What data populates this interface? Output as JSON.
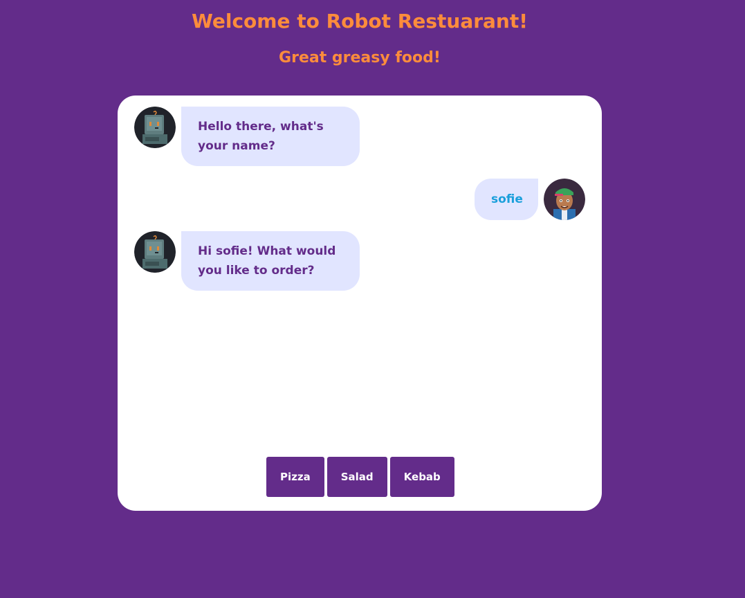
{
  "header": {
    "title": "Welcome to Robot Restuarant!",
    "subtitle": "Great greasy food!"
  },
  "chat": {
    "messages": [
      {
        "sender": "bot",
        "avatar": "robot-avatar",
        "text": "Hello there, what's your name?"
      },
      {
        "sender": "user",
        "avatar": "user-avatar",
        "text": "sofie"
      },
      {
        "sender": "bot",
        "avatar": "robot-avatar",
        "text": "Hi sofie! What would you like to order?"
      }
    ],
    "options": [
      "Pizza",
      "Salad",
      "Kebab"
    ]
  },
  "colors": {
    "background": "#632c8a",
    "heading": "#fc8c3c",
    "bubble": "#e1e5ff",
    "bot_text": "#632c8a",
    "user_text": "#1a9fdb",
    "button": "#632c8a"
  }
}
